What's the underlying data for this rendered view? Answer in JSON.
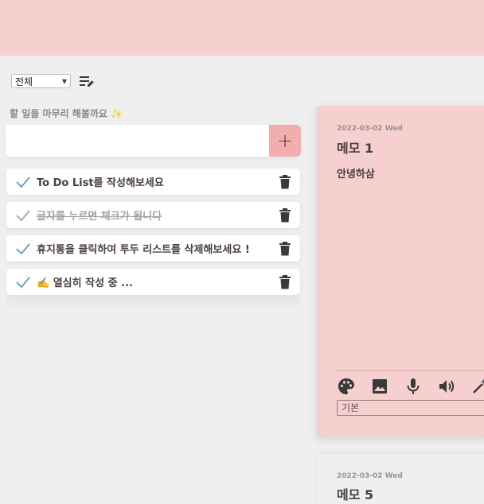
{
  "filter": {
    "selected": "전체"
  },
  "prompt": "할 일을 마무리 해볼까요 ✨",
  "add_button": "+",
  "todos": [
    {
      "text": "To Do List를 작성해보세요",
      "done": false
    },
    {
      "text": "글자를 누르면 체크가 됩니다",
      "done": true
    },
    {
      "text": "휴지통을 클릭하여 투두 리스트를 삭제해보세요 !",
      "done": false
    },
    {
      "text": "✍️ 열심히 작성 중 ...",
      "done": false
    }
  ],
  "memos": [
    {
      "date": "2022-03-02 Wed",
      "title": "메모 1",
      "body": "안녕하삼",
      "field_value": "기본"
    },
    {
      "date": "2022-03-02 Wed",
      "title": "메모 5"
    }
  ],
  "colors": {
    "header": "#f6cfcf",
    "accent": "#f2adae",
    "check": "#5f9fc2"
  }
}
